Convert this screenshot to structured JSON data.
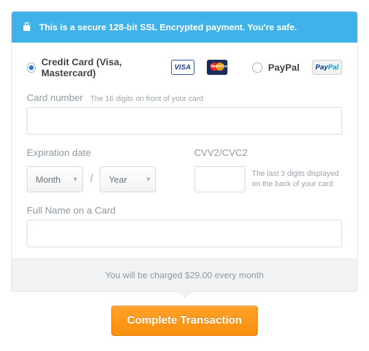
{
  "security_banner": "This is a secure 128-bit SSL Encrypted payment. You're safe.",
  "options": {
    "credit_label": "Credit Card (Visa, Mastercard)",
    "paypal_label": "PayPal"
  },
  "card_number": {
    "label": "Card number",
    "hint": "The 16 digits on front of your card"
  },
  "expiration": {
    "label": "Expiration date",
    "month": "Month",
    "year": "Year"
  },
  "cvv": {
    "label": "CVV2/CVC2",
    "hint": "The last 3 digits displayed on the back of your card"
  },
  "full_name": {
    "label": "Full Name on a Card"
  },
  "charge_notice": "You will be charged $29.00 every month",
  "submit_label": "Complete Transaction"
}
